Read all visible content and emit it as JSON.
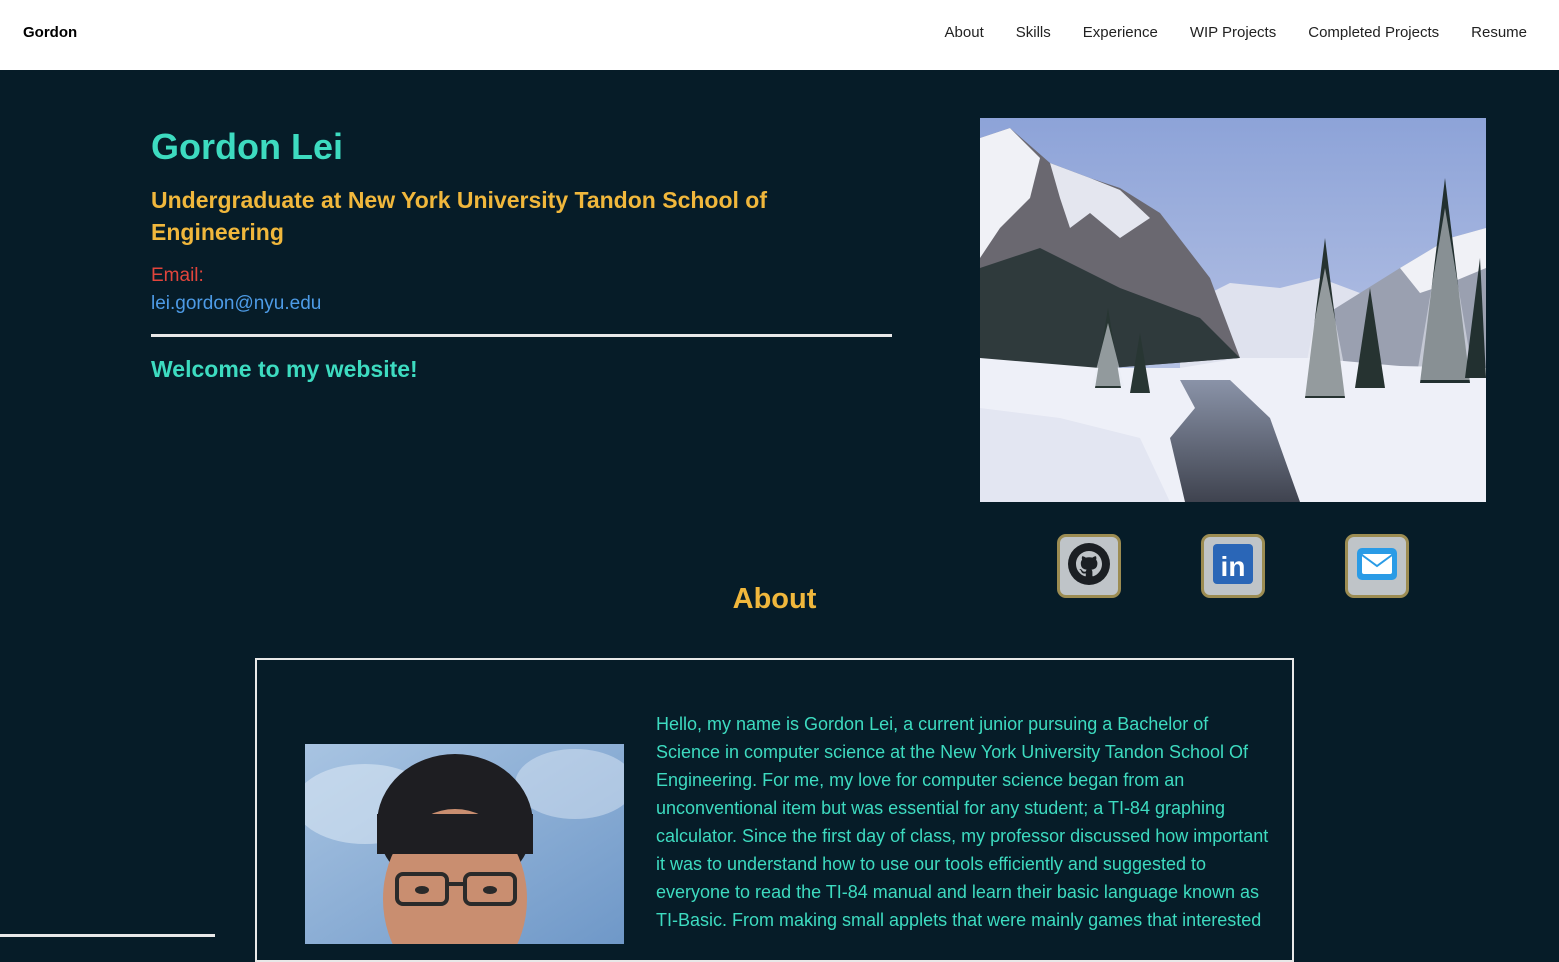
{
  "navbar": {
    "brand": "Gordon",
    "links": [
      "About",
      "Skills",
      "Experience",
      "WIP Projects",
      "Completed Projects",
      "Resume"
    ]
  },
  "hero": {
    "name": "Gordon Lei",
    "subtitle": "Undergraduate at New York University Tandon School of Engineering",
    "email_label": "Email:",
    "email": "lei.gordon@nyu.edu",
    "welcome": "Welcome to my website!"
  },
  "social": {
    "icons": [
      "github-icon",
      "linkedin-icon",
      "mail-icon"
    ],
    "linkedin_text": "in"
  },
  "about": {
    "heading": "About",
    "text": "Hello, my name is Gordon Lei, a current junior pursuing a Bachelor of Science in computer science at the New York University Tandon School Of Engineering. For me, my love for computer science began from an unconventional item but was essential for any student; a TI-84 graphing calculator. Since the first day of class, my professor discussed how important it was to understand how to use our tools efficiently and suggested to everyone to read the TI-84 manual and learn their basic language known as TI-Basic. From making small applets that were mainly games that interested"
  },
  "colors": {
    "background": "#061c28",
    "teal": "#3ddbc0",
    "gold": "#f0b73c",
    "red": "#e2453c",
    "link_blue": "#4d9be6"
  }
}
